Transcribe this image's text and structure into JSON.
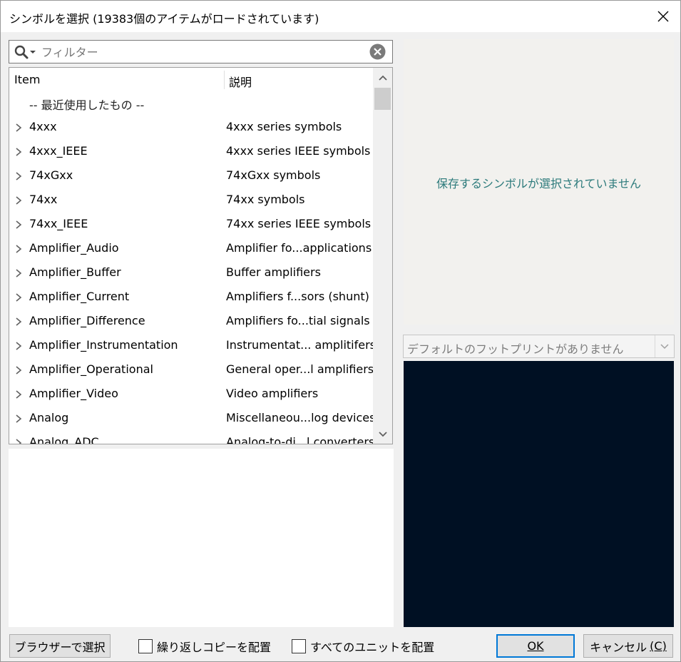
{
  "window": {
    "title": "シンボルを選択 (19383個のアイテムがロードされています)"
  },
  "filter": {
    "placeholder": "フィルター",
    "value": ""
  },
  "tree": {
    "columns": [
      "Item",
      "説明"
    ],
    "recent_label": "-- 最近使用したもの --",
    "rows": [
      {
        "name": "4xxx",
        "desc": "4xxx series symbols"
      },
      {
        "name": "4xxx_IEEE",
        "desc": "4xxx series IEEE symbols"
      },
      {
        "name": "74xGxx",
        "desc": "74xGxx symbols"
      },
      {
        "name": "74xx",
        "desc": "74xx symbols"
      },
      {
        "name": "74xx_IEEE",
        "desc": "74xx series IEEE symbols"
      },
      {
        "name": "Amplifier_Audio",
        "desc": "Amplifier fo...applications"
      },
      {
        "name": "Amplifier_Buffer",
        "desc": "Buffer amplifiers"
      },
      {
        "name": "Amplifier_Current",
        "desc": "Amplifiers f...sors (shunt)"
      },
      {
        "name": "Amplifier_Difference",
        "desc": "Amplifiers fo...tial signals"
      },
      {
        "name": "Amplifier_Instrumentation",
        "desc": "Instrumentat... amplitifers"
      },
      {
        "name": "Amplifier_Operational",
        "desc": "General oper...l amplifiers"
      },
      {
        "name": "Amplifier_Video",
        "desc": "Video amplifiers"
      },
      {
        "name": "Analog",
        "desc": "Miscellaneou...log devices"
      },
      {
        "name": "Analog_ADC",
        "desc": "Analog-to-di...l converters"
      }
    ],
    "scroll_position": 0.0
  },
  "preview": {
    "message": "保存するシンボルが選択されていません"
  },
  "footprint": {
    "selected": "デフォルトのフットプリントがありません"
  },
  "footer": {
    "browse_label": "ブラウザーで選択",
    "repeat_copy_label": "繰り返しコピーを配置",
    "repeat_copy_checked": false,
    "all_units_label": "すべてのユニットを配置",
    "all_units_checked": false,
    "ok_label": "OK",
    "cancel_label": "キャンセル",
    "cancel_accel": "(C)"
  },
  "colors": {
    "accent": "#0078d7",
    "preview_text": "#2c7a7b",
    "canvas_bg": "#001023"
  }
}
